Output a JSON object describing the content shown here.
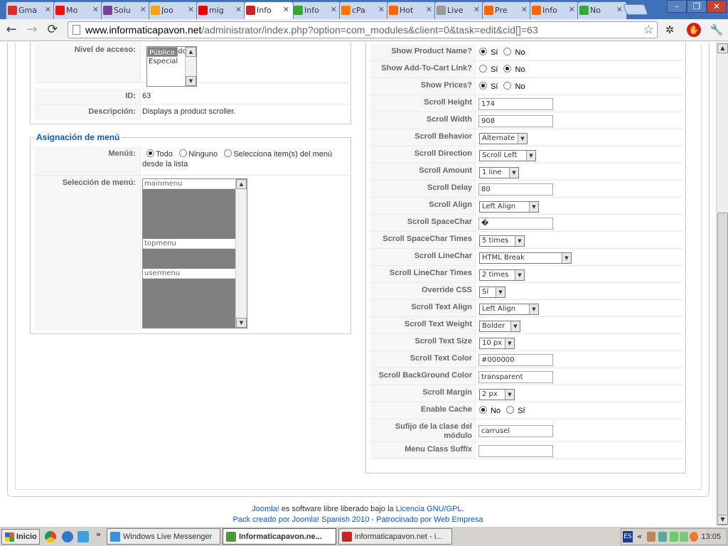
{
  "browser": {
    "tabs": [
      {
        "label": "Gma",
        "icon": "gmail-icon",
        "color": "#d93025"
      },
      {
        "label": "Mo",
        "icon": "mo-icon",
        "color": "#e11"
      },
      {
        "label": "Solu",
        "icon": "solu-icon",
        "color": "#7a3da0"
      },
      {
        "label": "Joo",
        "icon": "joomla-icon",
        "color": "#f4a21c"
      },
      {
        "label": "mig",
        "icon": "youtube-icon",
        "color": "#e00"
      },
      {
        "label": "Info",
        "icon": "info-icon",
        "color": "#c22"
      },
      {
        "label": "Info",
        "icon": "info2-icon",
        "color": "#3a3"
      },
      {
        "label": "cPa",
        "icon": "cpanel-icon",
        "color": "#f70"
      },
      {
        "label": "Hot",
        "icon": "hotmail-icon",
        "color": "#f60"
      },
      {
        "label": "Live",
        "icon": "page-icon",
        "color": "#999"
      },
      {
        "label": "Pre",
        "icon": "pre-icon",
        "color": "#f60"
      },
      {
        "label": "Info",
        "icon": "info3-icon",
        "color": "#f60"
      },
      {
        "label": "No",
        "icon": "no-icon",
        "color": "#3a3"
      }
    ],
    "active_tab_index": 5,
    "tab_close": "✕",
    "url_host": "www.informaticapavon.net",
    "url_rest": "/administrator/index.php?option=com_modules&client=0&task=edit&cid[]=63"
  },
  "left": {
    "access_label": "Nivel de acceso:",
    "access_options": [
      "Público",
      "Registrado",
      "Especial"
    ],
    "access_selected": 0,
    "id_label": "ID:",
    "id_value": "63",
    "desc_label": "Descripción:",
    "desc_value": "Displays a product scroller.",
    "menu_legend": "Asignación de menú",
    "menus_label": "Menús:",
    "menus_opt_all": "Todo",
    "menus_opt_none": "Ninguno",
    "menus_opt_select": "Selecciona item(s) del menú",
    "menus_opt_select_2": "desde la lista",
    "menu_sel_label": "Selección de menú:",
    "menu_items": [
      {
        "label": "mainmenu",
        "header": true
      },
      {
        "label": "",
        "header": false
      },
      {
        "label": "",
        "header": false
      },
      {
        "label": "",
        "header": false
      },
      {
        "label": "",
        "header": false
      },
      {
        "label": "",
        "header": false
      },
      {
        "label": "topmenu",
        "header": true
      },
      {
        "label": "",
        "header": false
      },
      {
        "label": "",
        "header": false
      },
      {
        "label": "usermenu",
        "header": true
      },
      {
        "label": "",
        "header": false
      },
      {
        "label": "",
        "header": false
      },
      {
        "label": "",
        "header": false
      },
      {
        "label": "",
        "header": false
      }
    ]
  },
  "params": [
    {
      "label": "Show Product Name?",
      "type": "radio",
      "options": [
        "Sí",
        "No"
      ],
      "selected": 0
    },
    {
      "label": "Show Add-To-Cart Link?",
      "type": "radio",
      "options": [
        "Sí",
        "No"
      ],
      "selected": 1
    },
    {
      "label": "Show Prices?",
      "type": "radio",
      "options": [
        "Sí",
        "No"
      ],
      "selected": 0
    },
    {
      "label": "Scroll Height",
      "type": "text",
      "value": "174"
    },
    {
      "label": "Scroll Width",
      "type": "text",
      "value": "908"
    },
    {
      "label": "Scroll Behavior",
      "type": "select",
      "value": "Alternate"
    },
    {
      "label": "Scroll Direction",
      "type": "select",
      "value": "Scroll Left"
    },
    {
      "label": "Scroll Amount",
      "type": "select",
      "value": "1 line"
    },
    {
      "label": "Scroll Delay",
      "type": "text",
      "value": "80"
    },
    {
      "label": "Scroll Align",
      "type": "select",
      "value": "Left Align"
    },
    {
      "label": "Scroll SpaceChar",
      "type": "text",
      "value": "�"
    },
    {
      "label": "Scroll SpaceChar Times",
      "type": "select",
      "value": "5 times"
    },
    {
      "label": "Scroll LineChar",
      "type": "select",
      "value": "HTML Break"
    },
    {
      "label": "Scroll LineChar Times",
      "type": "select",
      "value": "2 times"
    },
    {
      "label": "Override CSS",
      "type": "select",
      "value": "Sí"
    },
    {
      "label": "Scroll Text Align",
      "type": "select",
      "value": "Left Align"
    },
    {
      "label": "Scroll Text Weight",
      "type": "select",
      "value": "Bolder"
    },
    {
      "label": "Scroll Text Size",
      "type": "select",
      "value": "10 px"
    },
    {
      "label": "Scroll Text Color",
      "type": "text",
      "value": "#000000"
    },
    {
      "label": "Scroll BackGround Color",
      "type": "text",
      "value": "transparent"
    },
    {
      "label": "Scroll Margin",
      "type": "select",
      "value": "2 px"
    },
    {
      "label": "Enable Cache",
      "type": "radio",
      "options": [
        "No",
        "Sí"
      ],
      "selected": 0
    },
    {
      "label": "Sufijo de la clase del módulo",
      "type": "text",
      "value": "carrusel"
    },
    {
      "label": "Menu Class Suffix",
      "type": "text",
      "value": ""
    }
  ],
  "footer": {
    "brand": "Joomla!",
    "mid": " es software libre liberado bajo la ",
    "license": "Licencia GNU/GPL",
    "end": ".",
    "pack": "Pack creado por Joomla! Spanish 2010 - Patrocinado por Web Empresa"
  },
  "taskbar": {
    "start": "Inicio",
    "tasks": [
      {
        "label": "Windows Live Messenger",
        "color": "#3a8ee6",
        "active": false
      },
      {
        "label": "Informaticapavon.ne...",
        "color": "#4a9a3a",
        "active": true
      },
      {
        "label": "informaticapavon.net - i...",
        "color": "#c22",
        "active": false
      }
    ],
    "lang": "ES",
    "clock": "13:05"
  }
}
